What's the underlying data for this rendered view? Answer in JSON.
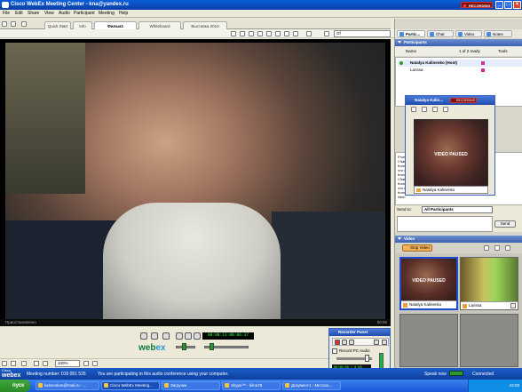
{
  "window": {
    "title": "Cisco WebEx Meeting Center - kna@yandex.ru",
    "recording_badge": "RECORDING"
  },
  "menu": [
    "File",
    "Edit",
    "Share",
    "View",
    "Audio",
    "Participant",
    "Meeting",
    "Help"
  ],
  "doc_tabs": [
    {
      "label": "Quick Start"
    },
    {
      "label": "Info"
    },
    {
      "label": "Фильм1",
      "active": true
    },
    {
      "label": "Whiteboard"
    },
    {
      "label": "Выставка 2010"
    }
  ],
  "toolbar": {
    "zoom_select": "Of"
  },
  "video_main": {
    "status_left": "Приостановлено",
    "status_right": "00:00",
    "timecode": "00:00:13:00:06:37"
  },
  "controls": {
    "zoom_value": "100%",
    "webex_logo_part1": "web",
    "webex_logo_part2": "ex"
  },
  "right_panel": {
    "tabs": [
      "Partic...",
      "Chat",
      "Video",
      "Notes"
    ],
    "participants": {
      "header": "Participants",
      "name_col": "Name",
      "count": "1 of 2 ready",
      "tools": "Tools",
      "people": [
        {
          "name": "Natalya Kalinenko (Host)"
        },
        {
          "name": "Larissa"
        }
      ]
    },
    "chat_lines": [
      "From",
      "I Nat",
      "from",
      "что о",
      "from",
      "I Nat",
      "from",
      "что п",
      "from",
      "Nem"
    ],
    "send_to_label": "Send to:",
    "send_to_value": "All Participants",
    "send_button": "Send",
    "video": {
      "header": "Video",
      "stop_video": "Stop Video",
      "thumbs": [
        {
          "name": "Natalya Kalinenko",
          "overlay": "VIDEO PAUSED"
        },
        {
          "name": "Larissa"
        }
      ]
    }
  },
  "float_video": {
    "title": "Natalya Kalin...",
    "rec": "RECORDING",
    "overlay": "VIDEO PAUSED",
    "caption": "Natalya Kalinenko"
  },
  "recorder": {
    "title": "Recorder Panel",
    "option": "Record PC Audio",
    "meter": "00:00:00 / 0 KB"
  },
  "statusbar": {
    "logo1": "Cisco",
    "logo2": "webex",
    "meeting_number": "Meeting number: 016 051 526",
    "audio_msg": "You are participating in this audio conference using your computer.",
    "speak_now": "Speak now",
    "connected": "Connected"
  },
  "taskbar": {
    "start": "пуск",
    "items": [
      {
        "label": "kalinenkon@mail.ru - ..."
      },
      {
        "label": "Cisco WebEx Meeting...",
        "active": true
      },
      {
        "label": "Загрузки"
      },
      {
        "label": "Skype™ - kilna78"
      },
      {
        "label": "Документ1 - Microso..."
      }
    ],
    "clock": "22:06"
  },
  "colors": {
    "accent": "#0a4fc8",
    "recording": "#7e0f0f",
    "tray": "#0f8ee8"
  }
}
